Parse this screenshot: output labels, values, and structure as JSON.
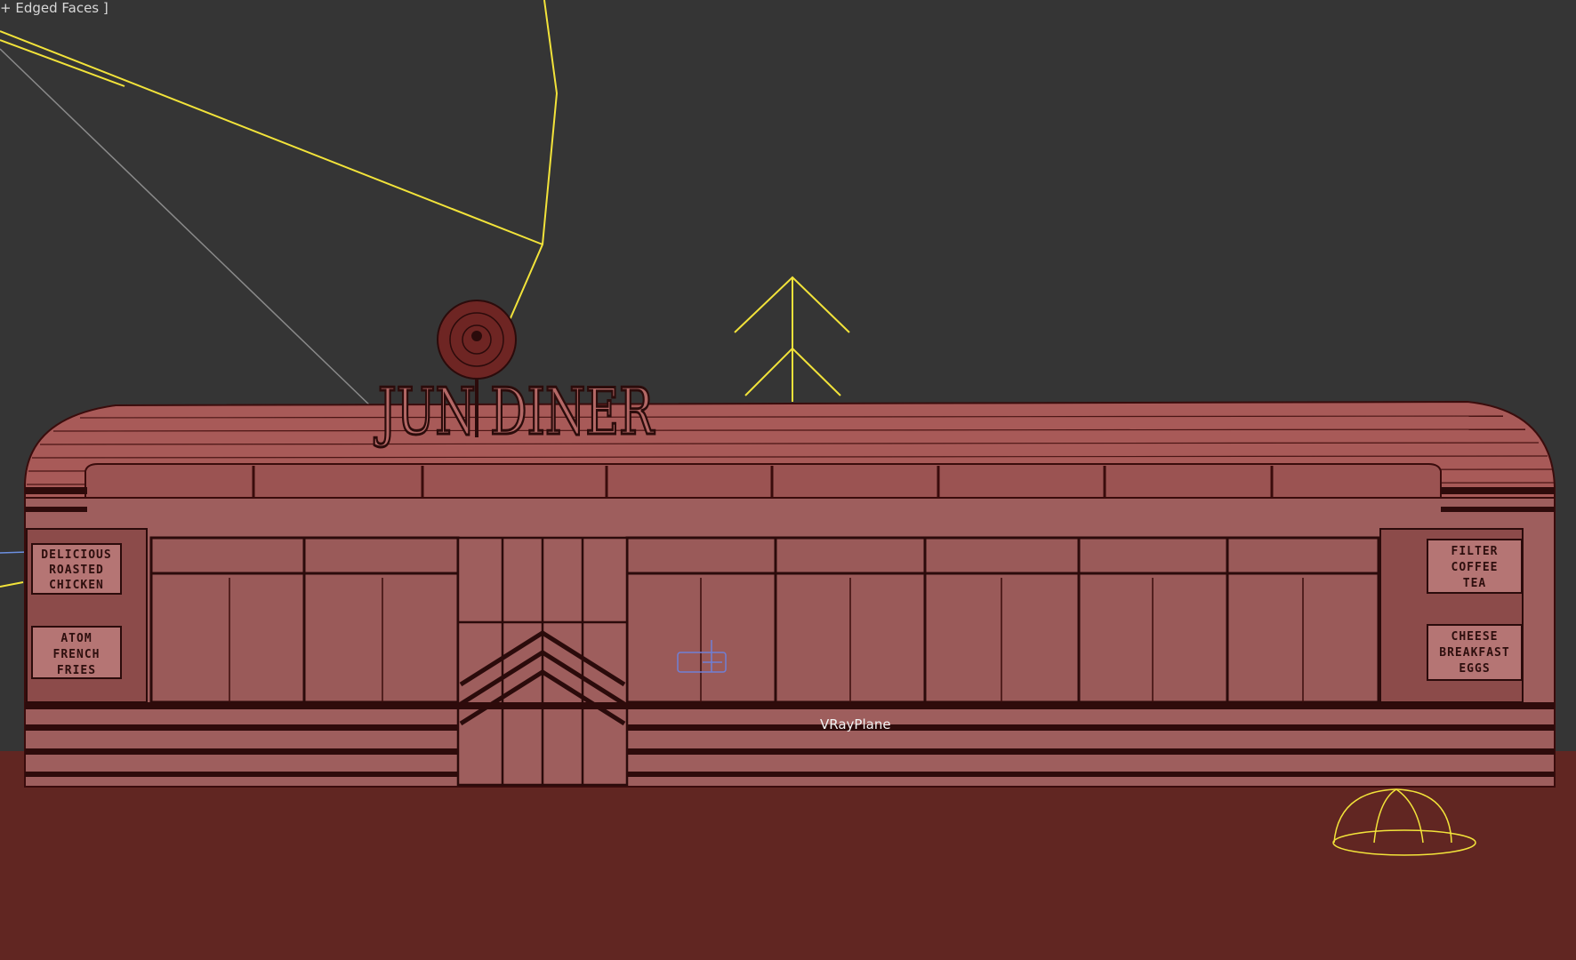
{
  "viewport": {
    "mode_label": "+ Edged Faces ]",
    "object_label": "VRayPlane"
  },
  "scene": {
    "sign_title": "JUN DINER",
    "left_menu_sign": [
      "DELICIOUS",
      "ROASTED",
      "CHICKEN",
      "ATOM",
      "FRENCH",
      "FRIES"
    ],
    "right_menu_sign": [
      "FILTER",
      "COFFEE",
      "TEA",
      "CHEESE",
      "BREAKFAST",
      "EGGS"
    ]
  },
  "colors": {
    "background": "#353535",
    "ground": "#612622",
    "wall": "#9e5e5d",
    "roof": "#a85a58",
    "wire": "#3a0c0c",
    "light_gizmo": "#f2e33a",
    "selection": "#6f7fd6"
  }
}
